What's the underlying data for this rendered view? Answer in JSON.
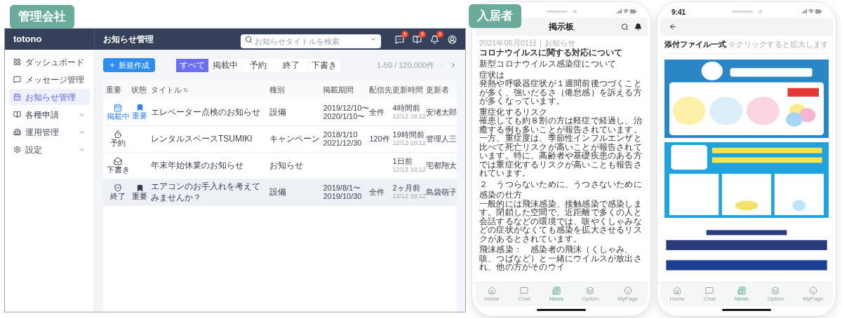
{
  "admin": {
    "badge": "管理会社",
    "logo": "totono",
    "page_title": "お知らせ管理",
    "search": {
      "placeholder": "お知らせタイトルを検索"
    },
    "header_icons": [
      {
        "kind": "chat",
        "count": "9"
      },
      {
        "kind": "book",
        "count": "9"
      },
      {
        "kind": "bell",
        "count": "9"
      },
      {
        "kind": "account"
      }
    ],
    "sidebar": {
      "items": [
        {
          "kind": "dashboard",
          "label": "ダッシュボード",
          "selected": false
        },
        {
          "kind": "message",
          "label": "メッセージ管理",
          "selected": false
        },
        {
          "kind": "notice",
          "label": "お知らせ管理",
          "selected": true
        },
        {
          "kind": "application",
          "label": "各種申請",
          "selected": false,
          "expandable": true
        },
        {
          "kind": "operation",
          "label": "運用管理",
          "selected": false,
          "expandable": true
        },
        {
          "kind": "settings",
          "label": "設定",
          "selected": false,
          "expandable": true
        }
      ]
    },
    "new_button": "新規作成",
    "tabs": [
      {
        "label": "すべて",
        "selected": true
      },
      {
        "label": "掲載中",
        "selected": false
      },
      {
        "label": "予約",
        "selected": false
      },
      {
        "label": "終了",
        "selected": false
      },
      {
        "label": "下書き",
        "selected": false
      }
    ],
    "pager": {
      "range": "1-50 / 120,000件",
      "prev_disabled": true,
      "next_disabled": false
    },
    "table": {
      "columns": [
        "重要",
        "状態",
        "タイトル",
        "種別",
        "掲載期間",
        "配信先",
        "更新時間",
        "更新者"
      ],
      "rows": [
        {
          "status": {
            "kind": "published",
            "label": "掲載中"
          },
          "important": {
            "label": "重要"
          },
          "title": "エレベーター点検のお知らせ",
          "type": "設備",
          "period": [
            "2019/12/10〜",
            "2020/1/10〜"
          ],
          "recipients": "全件",
          "updated": "4時間前",
          "updated_at": "12/12 18:12",
          "updater": "安堵太郎",
          "selected": false
        },
        {
          "status": {
            "kind": "scheduled",
            "label": "予約"
          },
          "title": "レンタルスペースTSUMIKI",
          "type": "キャンペーン",
          "period": [
            "2018/1/10",
            "2021/12/30"
          ],
          "recipients": "120件",
          "updated": "19時間前",
          "updated_at": "12/12 18:12",
          "updater": "管理人三",
          "selected": false
        },
        {
          "status": {
            "kind": "draft",
            "label": "下書き"
          },
          "title": "年末年始休業のお知らせ",
          "type": "お知らせ",
          "updated": "1日前",
          "updated_at": "12/12 18:12",
          "updater": "宅都翔太",
          "selected": false
        },
        {
          "status": {
            "kind": "ended",
            "label": "終了"
          },
          "important": {
            "label": "重要"
          },
          "title": "エアコンのお手入れを考えてみませんか？",
          "type": "設備",
          "period": [
            "2019/8/1〜",
            "2019/10/30"
          ],
          "recipients": "全件",
          "updated": "2ヶ月前",
          "updated_at": "12/12 18:12",
          "updater": "島袋萌子",
          "selected": true
        }
      ]
    }
  },
  "resident": {
    "badge": "入居者",
    "phones": [
      {
        "kind": "article",
        "header_title": "掲示板",
        "date": "2021年06月01日｜お知らせ",
        "title": "コロナウイルスに関する対応について",
        "body": [
          {
            "lines": [
              "新型コロナウイルス感染症について"
            ]
          },
          {
            "lines": [
              "症状は",
              "発熱や呼吸器症状が１週間前後つづくことが多く、強いだるさ（倦怠感）を訴える方が多くなっています。"
            ]
          },
          {
            "lines": [
              "重症化するリスク",
              "罹患しても約８割の方は軽症で経過し、治癒する例も多いことが報告されています。一方、重症度は、季節性インフルエンザと比べて死亡リスクが高いことが報告されています。特に、高齢者や基礎疾患のある方では重症化するリスクが高いことも報告されています。"
            ]
          },
          {
            "lines": [
              "２　うつらないために、うつさないために"
            ]
          },
          {
            "lines": [
              "感染の仕方",
              "一般的には飛沫感染、接触感染で感染します。閉鎖した空間で、近距離で多くの人と会話するなどの環境では、咳やくしゃみなどの症状がなくても感染を拡大させるリスクがあるとされています。"
            ]
          },
          {
            "lines": [
              "飛沫感染：　感染者の飛沫（くしゃみ、咳、つばなど）と一緒にウイルスが放出され、他の方がそのウイ"
            ]
          }
        ],
        "tabbar": [
          {
            "kind": "home",
            "label": "Home",
            "selected": false
          },
          {
            "kind": "chat",
            "label": "Chat",
            "selected": false
          },
          {
            "kind": "news",
            "label": "News",
            "selected": true
          },
          {
            "kind": "option",
            "label": "Option",
            "selected": false
          },
          {
            "kind": "mypage",
            "label": "MyPage",
            "selected": false
          }
        ]
      },
      {
        "kind": "attachments",
        "time": "9:41",
        "section_title": "添付ファイル一式",
        "hint": "※クリックすると拡大します",
        "images": [
          {
            "kind": "picture"
          },
          {
            "kind": "picture"
          },
          {
            "kind": "picture"
          }
        ],
        "tabbar": [
          {
            "kind": "home",
            "label": "Home",
            "selected": false
          },
          {
            "kind": "chat",
            "label": "Chat",
            "selected": false
          },
          {
            "kind": "news",
            "label": "News",
            "selected": true
          },
          {
            "kind": "option",
            "label": "Option",
            "selected": false
          },
          {
            "kind": "mypage",
            "label": "MyPage",
            "selected": false
          }
        ]
      }
    ]
  }
}
